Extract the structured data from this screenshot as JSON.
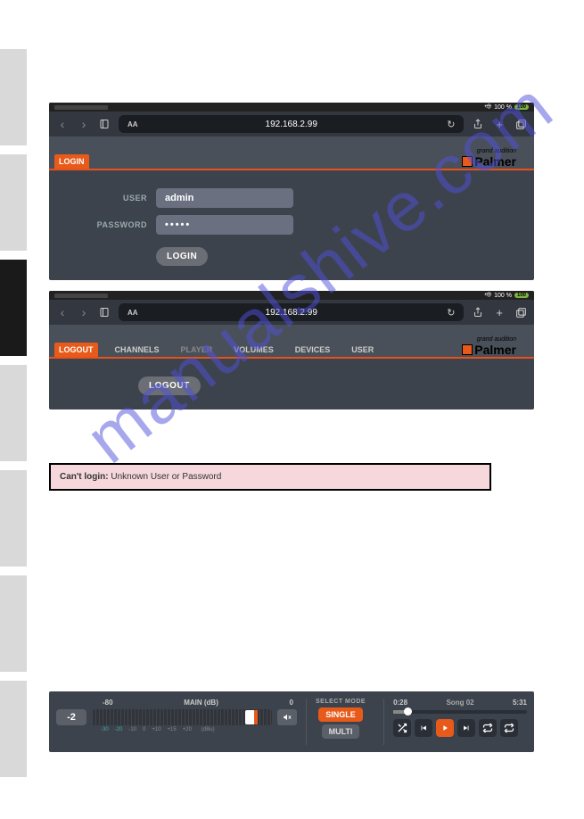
{
  "sidebar": {
    "activeIndex": 2
  },
  "status": {
    "wifi": "100 %",
    "battery": "100"
  },
  "browser": {
    "url": "192.168.2.99",
    "aa": "AA"
  },
  "brand": {
    "sub": "grand audition",
    "name": "Palmer"
  },
  "login": {
    "tab": "LOGIN",
    "userLabel": "USER",
    "userValue": "admin",
    "passwordLabel": "PASSWORD",
    "passwordValue": "•••••",
    "button": "LOGIN"
  },
  "nav": {
    "tabs": [
      {
        "label": "LOGOUT",
        "active": true
      },
      {
        "label": "CHANNELS"
      },
      {
        "label": "PLAYER",
        "muted": true
      },
      {
        "label": "VOLUMES"
      },
      {
        "label": "DEVICES"
      },
      {
        "label": "USER"
      }
    ],
    "logoutButton": "LOGOUT"
  },
  "error": {
    "bold": "Can't login:",
    "message": " Unknown User or Password"
  },
  "player": {
    "vol": {
      "min": "-80",
      "title": "MAIN (dB)",
      "max": "0",
      "value": "-2",
      "scale": [
        "-30",
        "-20",
        "-10",
        "0",
        "+10",
        "+15",
        "+20"
      ],
      "scaleUnit": "(dBu)"
    },
    "mode": {
      "title": "SELECT MODE",
      "single": "SINGLE",
      "multi": "MULTI"
    },
    "track": {
      "elapsed": "0:28",
      "name": "Song 02",
      "total": "5:31"
    }
  }
}
